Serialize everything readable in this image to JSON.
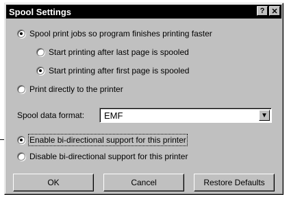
{
  "window": {
    "title": "Spool Settings",
    "help_label": "?",
    "close_label": "✕"
  },
  "options": {
    "spool": "Spool print jobs so program finishes printing faster",
    "after_last": "Start printing after last page is spooled",
    "after_first": "Start printing after first page is spooled",
    "direct": "Print directly to the printer",
    "selected_spool_mode": "spool",
    "selected_start": "after_first"
  },
  "format": {
    "label": "Spool data format:",
    "value": "EMF",
    "arrow": "▼"
  },
  "bidi": {
    "enable": "Enable bi-directional support for this printer",
    "disable": "Disable bi-directional support for this printer",
    "selected": "enable"
  },
  "buttons": {
    "ok": "OK",
    "cancel": "Cancel",
    "restore": "Restore Defaults"
  }
}
